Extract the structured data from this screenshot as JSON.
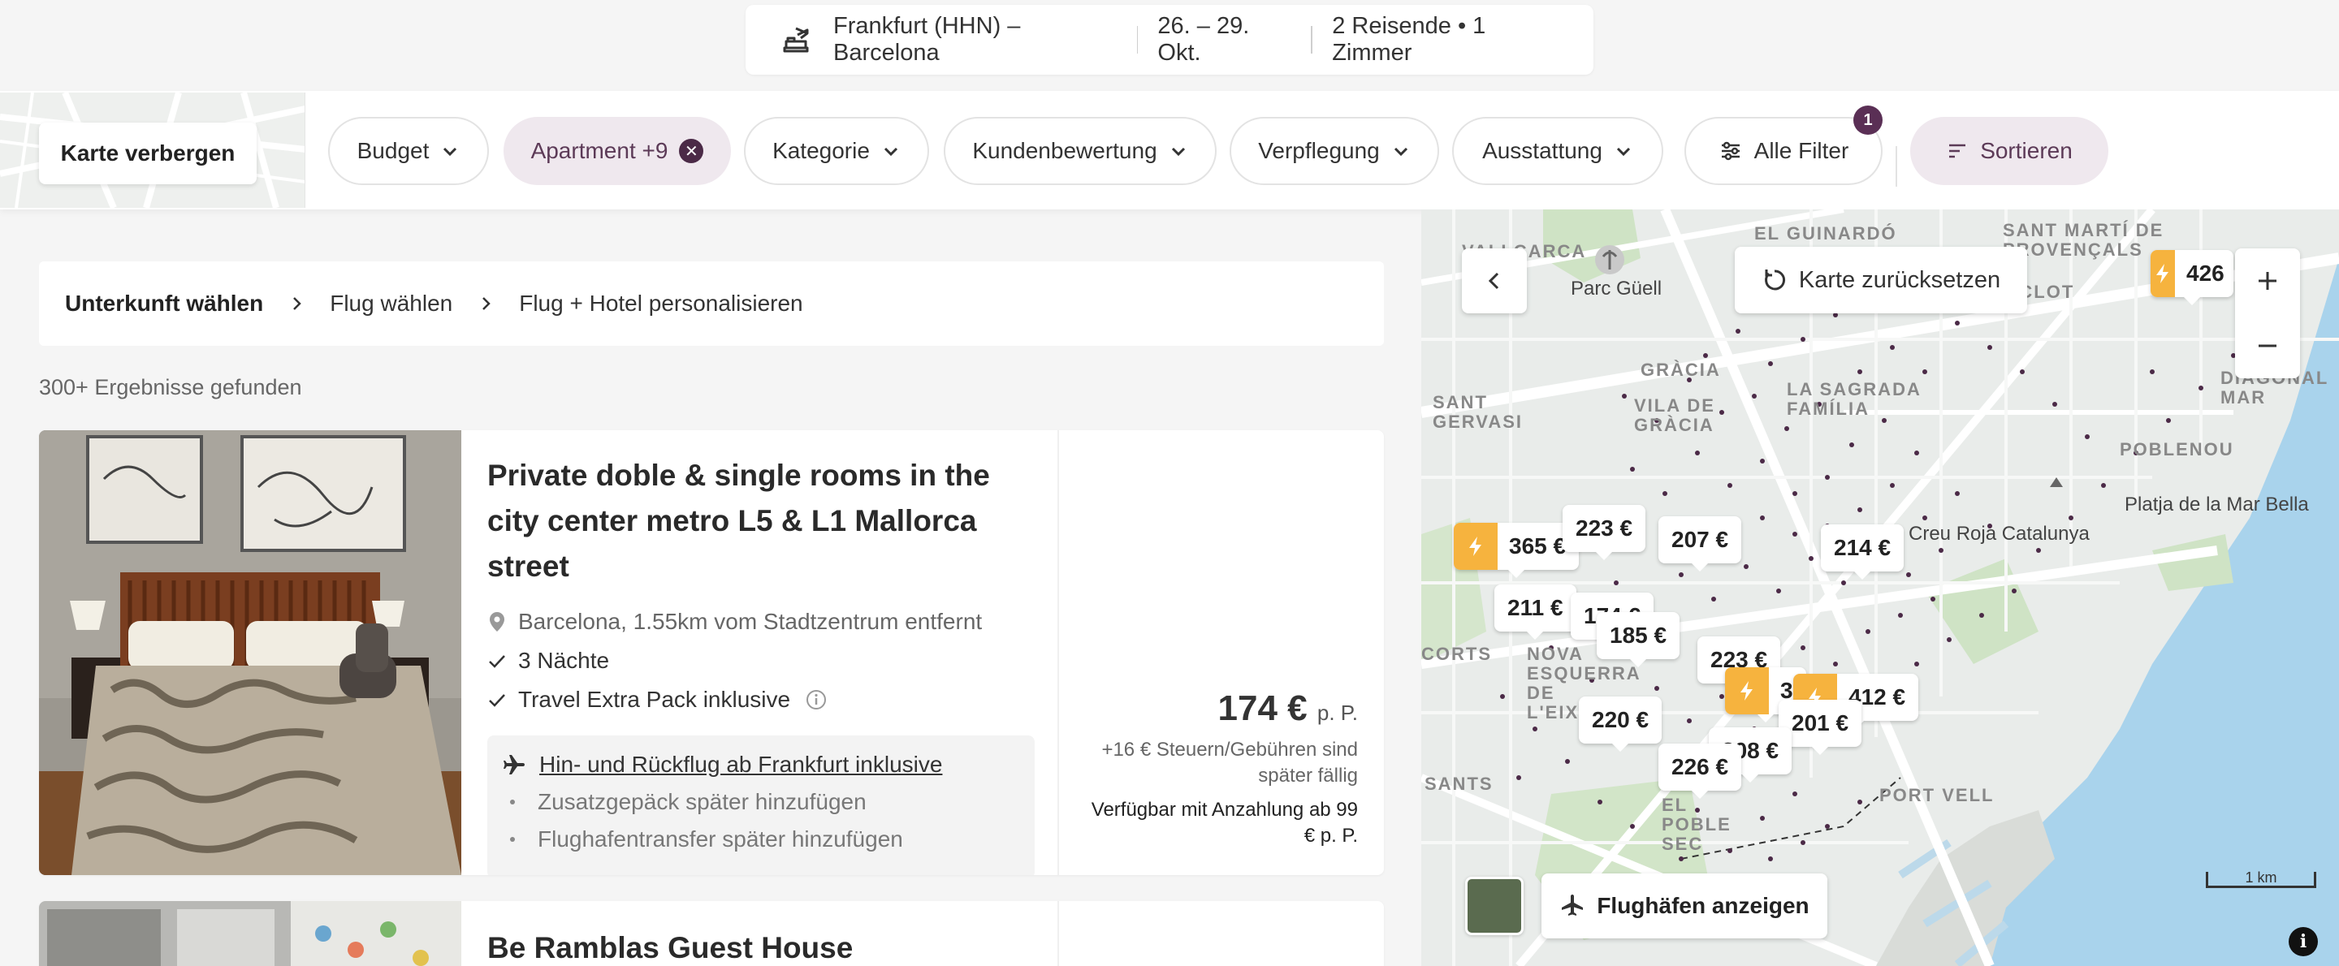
{
  "search": {
    "route": "Frankfurt (HHN) – Barcelona",
    "dates": "26. – 29. Okt.",
    "guests": "2 Reisende • 1 Zimmer"
  },
  "filters": {
    "map_toggle": "Karte verbergen",
    "budget": "Budget",
    "apartment": "Apartment +9",
    "kategorie": "Kategorie",
    "kundenbewertung": "Kundenbewertung",
    "verpflegung": "Verpflegung",
    "ausstattung": "Ausstattung",
    "alle_filter": "Alle Filter",
    "alle_filter_count": "1",
    "sortieren": "Sortieren"
  },
  "breadcrumb": {
    "step1": "Unterkunft wählen",
    "step2": "Flug wählen",
    "step3": "Flug + Hotel personalisieren"
  },
  "results_count": "300+ Ergebnisse gefunden",
  "listings": [
    {
      "title": "Private doble & single rooms in the city center metro L5 & L1 Mallorca street",
      "location": "Barcelona, 1.55km vom Stadtzentrum entfernt",
      "features": [
        "3 Nächte",
        "Travel Extra Pack inklusive"
      ],
      "flight": "Hin- und Rückflug ab Frankfurt inklusive",
      "extras": [
        "Zusatzgepäck später hinzufügen",
        "Flughafentransfer später hinzufügen"
      ],
      "price": "174 €",
      "price_unit": "p. P.",
      "tax_note": "+16 € Steuern/Gebühren sind später fällig",
      "deposit_note": "Verfügbar mit Anzahlung ab 99 € p. P."
    },
    {
      "title": "Be Ramblas Guest House"
    }
  ],
  "map": {
    "reset": "Karte zurücksetzen",
    "airports": "Flughäfen anzeigen",
    "scale": "1 km",
    "info": "i",
    "labels": {
      "vallcarca": "Vallcarca",
      "guinardo": "El Guinardó",
      "sant_marti": "Sant Martí de Provençals",
      "parc_guell": "Parc Güell",
      "camp_arpa": "El Camp de l'Arpa del Clot",
      "gracia": "Gràcia",
      "vila_gracia": "Vila de Gràcia",
      "sagrada": "La Sagrada Família",
      "sant_gervasi": "Sant Gervasi",
      "diagonal_mar": "Diagonal Mar",
      "poblenou": "Poblenou",
      "platja": "Platja de la Mar Bella",
      "creu_roja": "Creu Roja Catalunya",
      "corts": "Corts",
      "nova_esquerra": "Nova Esquerra de l'Eixample",
      "sants": "Sants",
      "poble_sec": "El Poble Sec",
      "port_vell": "Port Vell"
    },
    "markers": [
      "365 €",
      "223 €",
      "207 €",
      "214 €",
      "211 €",
      "174 €",
      "185 €",
      "223 €",
      "3",
      "412 €",
      "220 €",
      "201 €",
      "208 €",
      "226 €",
      "426"
    ]
  },
  "colors": {
    "accent": "#5a2f55",
    "chip_active_bg": "#efe8ee",
    "bolt": "#f6b33e",
    "map_water": "#a9d3ec",
    "map_park": "#cfe3c5"
  }
}
